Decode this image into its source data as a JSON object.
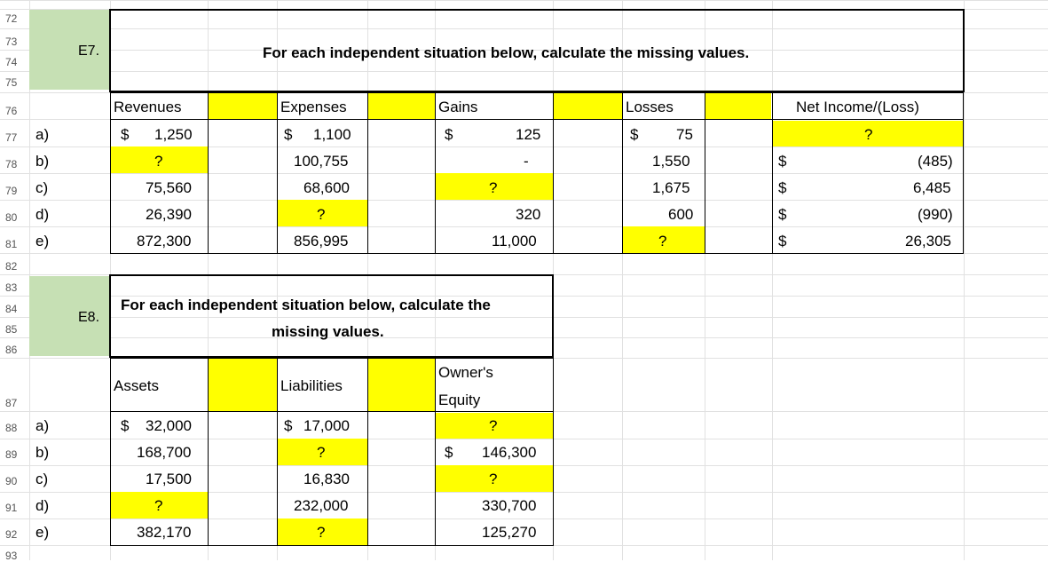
{
  "row_numbers": [
    "72",
    "73",
    "74",
    "75",
    "76",
    "77",
    "78",
    "79",
    "80",
    "81",
    "82",
    "83",
    "84",
    "85",
    "86",
    "87",
    "88",
    "89",
    "90",
    "91",
    "92",
    "93"
  ],
  "e7": {
    "label": "E7.",
    "title": "For each independent situation below, calculate the missing values.",
    "headers": {
      "revenues": "Revenues",
      "expenses": "Expenses",
      "gains": "Gains",
      "losses": "Losses",
      "net": "Net Income/(Loss)"
    },
    "row_labels": [
      "a)",
      "b)",
      "c)",
      "d)",
      "e)"
    ],
    "revenues": [
      "1,250",
      "?",
      "75,560",
      "26,390",
      "872,300"
    ],
    "expenses": [
      "1,100",
      "100,755",
      "68,600",
      "?",
      "856,995"
    ],
    "gains": [
      "125",
      "-",
      "?",
      "320",
      "11,000"
    ],
    "losses": [
      "75",
      "1,550",
      "1,675",
      "600",
      "?"
    ],
    "net": [
      "?",
      "(485)",
      "6,485",
      "(990)",
      "26,305"
    ],
    "dollar": "$"
  },
  "e8": {
    "label": "E8.",
    "title_line1": "For each independent situation below, calculate the",
    "title_line2": "missing values.",
    "headers": {
      "assets": "Assets",
      "liabilities": "Liabilities",
      "equity_line1": "Owner's",
      "equity_line2": "Equity"
    },
    "row_labels": [
      "a)",
      "b)",
      "c)",
      "d)",
      "e)"
    ],
    "assets": [
      "32,000",
      "168,700",
      "17,500",
      "?",
      "382,170"
    ],
    "liabilities": [
      "17,000",
      "?",
      "16,830",
      "232,000",
      "?"
    ],
    "equity": [
      "?",
      "146,300",
      "?",
      "330,700",
      "125,270"
    ],
    "dollar": "$"
  }
}
